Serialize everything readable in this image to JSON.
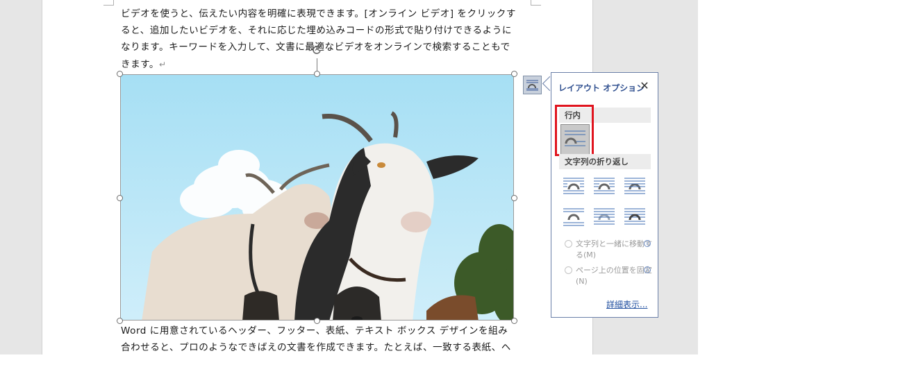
{
  "document": {
    "paragraph_top": "ビデオを使うと、伝えたい内容を明確に表現できます。[オンライン ビデオ] をクリックすると、追加したいビデオを、それに応じた埋め込みコードの形式で貼り付けできるようになります。キーワードを入力して、文書に最適なビデオをオンラインで検索することもできます。",
    "paragraph_mark": "↵",
    "paragraph_bottom": "Word に用意されているヘッダー、フッター、表紙、テキスト ボックス デザインを組み合わせると、プロのようなできばえの文書を作成できます。たとえば、一致する表紙、ヘッダ"
  },
  "layout_options": {
    "title": "レイアウト オプション",
    "close_glyph": "✕",
    "inline_section": "行内",
    "wrap_section": "文字列の折り返し",
    "move_with_text": "文字列と一緒に移動する(M)",
    "fix_position": "ページ上の位置を固定(N)",
    "info_glyph": "i",
    "see_more": "詳細表示..."
  },
  "icons": [
    "layout-options-icon",
    "rotate-icon",
    "close-icon",
    "info-icon"
  ],
  "colors": {
    "accent": "#2f4f8f",
    "highlight": "#e0141e",
    "sky": "#aee3f5"
  }
}
